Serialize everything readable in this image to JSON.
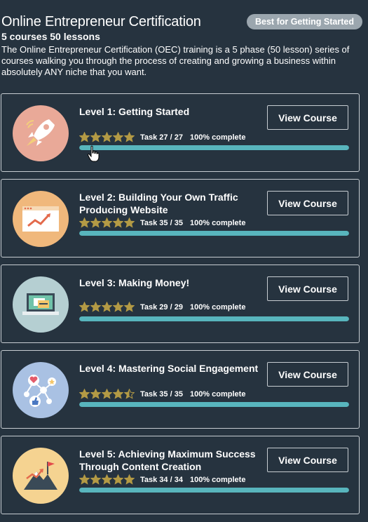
{
  "header": {
    "title": "Online Entrepreneur Certification",
    "badge": "Best for Getting Started",
    "subtitle": "5 courses 50 lessons",
    "description": "The Online Entrepreneur Certification (OEC) training is a 5 phase (50 lesson) series of courses walking you through the process of creating and growing a business within absolutely ANY niche that you want."
  },
  "colors": {
    "background": "#26333f",
    "progress_fill": "#58b5bd",
    "star": "#b39a45"
  },
  "courses": [
    {
      "title": "Level 1: Getting Started",
      "rating": 5,
      "task": "Task 27 / 27",
      "complete": "100% complete",
      "progress": 1.0,
      "button": "View Course",
      "icon": "rocket-icon",
      "icon_bg": "#e9a998"
    },
    {
      "title": "Level 2: Building Your Own Traffic Producing Website",
      "rating": 5,
      "task": "Task 35 / 35",
      "complete": "100% complete",
      "progress": 1.0,
      "button": "View Course",
      "icon": "website-chart-icon",
      "icon_bg": "#f0b87c"
    },
    {
      "title": "Level 3: Making Money!",
      "rating": 5,
      "task": "Task 29 / 29",
      "complete": "100% complete",
      "progress": 1.0,
      "button": "View Course",
      "icon": "laptop-payment-icon",
      "icon_bg": "#b5cfd2"
    },
    {
      "title": "Level 4: Mastering Social Engagement",
      "rating": 4.5,
      "task": "Task 35 / 35",
      "complete": "100% complete",
      "progress": 1.0,
      "button": "View Course",
      "icon": "social-network-icon",
      "icon_bg": "#a9c1e3"
    },
    {
      "title": "Level 5: Achieving Maximum Success Through Content Creation",
      "rating": 5,
      "task": "Task 34 / 34",
      "complete": "100% complete",
      "progress": 1.0,
      "button": "View Course",
      "icon": "mountain-flag-icon",
      "icon_bg": "#f5d391"
    }
  ]
}
